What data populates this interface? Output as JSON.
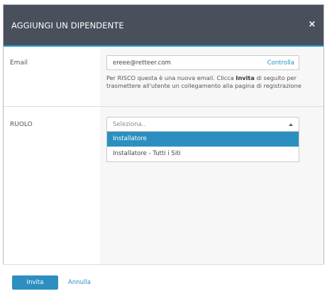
{
  "modal": {
    "title": "AGGIUNGI UN DIPENDENTE",
    "close_icon": "close-icon",
    "close_glyph": "×"
  },
  "form": {
    "email": {
      "label": "Email",
      "value": "ereee@retteer.com",
      "verify_label": "Controlla",
      "help_prefix": "Per RISCO questa è una nuova email. Clicca ",
      "help_bold": "Invita",
      "help_suffix": " di seguito per trasmettere all'utente un collegamento alla pagina di registrazione"
    },
    "role": {
      "label": "RUOLO",
      "placeholder": "Seleziona..",
      "options": [
        {
          "label": "Installatore",
          "highlighted": true
        },
        {
          "label": "Installatore - Tutti i Siti",
          "highlighted": false
        }
      ]
    }
  },
  "footer": {
    "primary_label": "Invita",
    "secondary_label": "Annulla"
  },
  "colors": {
    "header_bg": "#49505c",
    "accent": "#2c8fc0",
    "link": "#2a8fc6"
  }
}
